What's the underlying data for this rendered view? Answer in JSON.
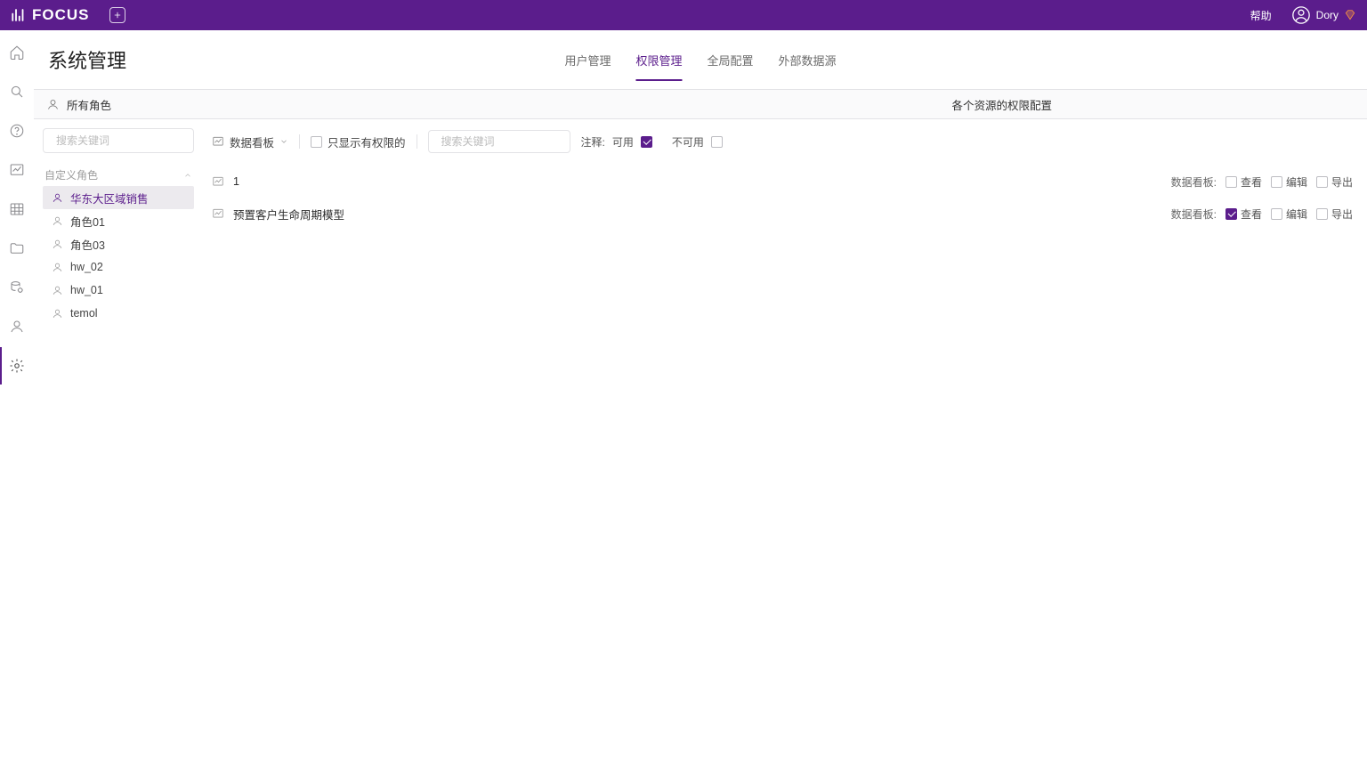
{
  "header": {
    "brand": "FOCUS",
    "help": "帮助",
    "user": "Dory"
  },
  "rail": {
    "items": [
      "home",
      "search",
      "help-circle",
      "dashboard",
      "grid",
      "folder",
      "data-mgmt",
      "user",
      "settings"
    ],
    "active_index": 8
  },
  "page": {
    "title": "系统管理",
    "tabs": [
      "用户管理",
      "权限管理",
      "全局配置",
      "外部数据源"
    ],
    "active_tab_index": 1
  },
  "section": {
    "left_title": "所有角色",
    "right_title": "各个资源的权限配置"
  },
  "role_search_placeholder": "搜索关键词",
  "role_group_label": "自定义角色",
  "roles": [
    {
      "name": "华东大区域销售",
      "selected": true
    },
    {
      "name": "角色01",
      "selected": false
    },
    {
      "name": "角色03",
      "selected": false
    },
    {
      "name": "hw_02",
      "selected": false
    },
    {
      "name": "hw_01",
      "selected": false
    },
    {
      "name": "temol",
      "selected": false
    }
  ],
  "toolbar": {
    "resource_type": "数据看板",
    "only_permitted_label": "只显示有权限的",
    "only_permitted_checked": false,
    "res_search_placeholder": "搜索关键词",
    "legend_prefix": "注释:",
    "legend_available": "可用",
    "legend_unavailable": "不可用",
    "legend_available_checked": true,
    "legend_unavailable_checked": false
  },
  "perm_columns": {
    "group_label": "数据看板:",
    "view": "查看",
    "edit": "编辑",
    "export": "导出"
  },
  "resources": [
    {
      "name": "1",
      "view": false,
      "edit": false,
      "export": false
    },
    {
      "name": "预置客户生命周期模型",
      "view": true,
      "edit": false,
      "export": false
    }
  ]
}
